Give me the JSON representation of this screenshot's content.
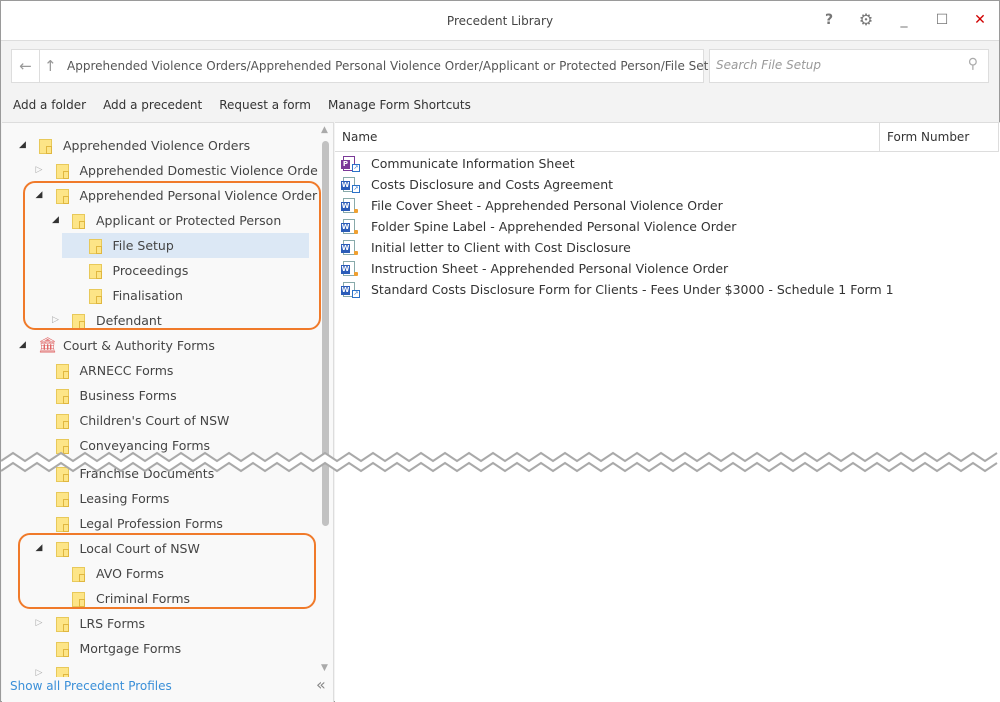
{
  "window": {
    "title": "Precedent Library",
    "controls": [
      "help-icon",
      "gear-icon",
      "minimize-icon",
      "maximize-icon",
      "close-icon"
    ]
  },
  "address": {
    "path": "Apprehended Violence Orders/Apprehended Personal Violence Order/Applicant or Protected Person/File Setup"
  },
  "search": {
    "placeholder": "Search File Setup"
  },
  "actions": [
    "Add a folder",
    "Add a precedent",
    "Request a form",
    "Manage Form Shortcuts"
  ],
  "tree": [
    {
      "label": "Apprehended Violence Orders",
      "level": 0,
      "toggle": "expanded",
      "icon": "folder-doc"
    },
    {
      "label": "Apprehended Domestic Violence Order",
      "level": 1,
      "toggle": "collapsed",
      "icon": "folder"
    },
    {
      "label": "Apprehended Personal Violence Order",
      "level": 1,
      "toggle": "expanded",
      "icon": "folder"
    },
    {
      "label": "Applicant or Protected Person",
      "level": 2,
      "toggle": "expanded",
      "icon": "folder"
    },
    {
      "label": "File Setup",
      "level": 3,
      "toggle": "none",
      "icon": "folder",
      "selected": true
    },
    {
      "label": "Proceedings",
      "level": 3,
      "toggle": "none",
      "icon": "folder"
    },
    {
      "label": "Finalisation",
      "level": 3,
      "toggle": "none",
      "icon": "folder"
    },
    {
      "label": "Defendant",
      "level": 2,
      "toggle": "collapsed",
      "icon": "folder"
    },
    {
      "label": "Court & Authority Forms",
      "level": 0,
      "toggle": "expanded",
      "icon": "bank"
    },
    {
      "label": "ARNECC Forms",
      "level": 1,
      "toggle": "none",
      "icon": "folder"
    },
    {
      "label": "Business Forms",
      "level": 1,
      "toggle": "none",
      "icon": "folder"
    },
    {
      "label": "Children's Court of NSW",
      "level": 1,
      "toggle": "none",
      "icon": "folder"
    },
    {
      "label": "Conveyancing Forms",
      "level": 1,
      "toggle": "none",
      "icon": "folder"
    },
    {
      "label": "Franchise Documents",
      "level": 1,
      "toggle": "none",
      "icon": "folder"
    },
    {
      "label": "Leasing Forms",
      "level": 1,
      "toggle": "none",
      "icon": "folder"
    },
    {
      "label": "Legal Profession Forms",
      "level": 1,
      "toggle": "none",
      "icon": "folder"
    },
    {
      "label": "Local Court of NSW",
      "level": 1,
      "toggle": "expanded",
      "icon": "folder"
    },
    {
      "label": "AVO Forms",
      "level": 2,
      "toggle": "none",
      "icon": "folder"
    },
    {
      "label": "Criminal Forms",
      "level": 2,
      "toggle": "none",
      "icon": "folder"
    },
    {
      "label": "LRS Forms",
      "level": 1,
      "toggle": "collapsed",
      "icon": "folder"
    },
    {
      "label": "Mortgage Forms",
      "level": 1,
      "toggle": "none",
      "icon": "folder"
    },
    {
      "label": "",
      "level": 1,
      "toggle": "collapsed",
      "icon": "folder"
    }
  ],
  "footer": {
    "link": "Show all Precedent Profiles"
  },
  "columns": {
    "name": "Name",
    "form_number": "Form Number"
  },
  "files": [
    {
      "name": "Communicate Information Sheet",
      "type": "pdf-shortcut"
    },
    {
      "name": "Costs Disclosure and Costs Agreement",
      "type": "word-shortcut"
    },
    {
      "name": "File Cover Sheet - Apprehended Personal Violence Order",
      "type": "word-local"
    },
    {
      "name": "Folder Spine Label - Apprehended Personal Violence Order",
      "type": "word-local"
    },
    {
      "name": "Initial letter to Client with Cost Disclosure",
      "type": "word-local"
    },
    {
      "name": "Instruction Sheet - Apprehended Personal Violence Order",
      "type": "word-local"
    },
    {
      "name": "Standard Costs Disclosure Form for Clients - Fees Under $3000 - Schedule 1 Form 1",
      "type": "word-shortcut"
    }
  ],
  "colors": {
    "highlight": "#f07a2a",
    "selection": "#dce8f5",
    "link": "#3a8fd8",
    "close": "#d00000"
  }
}
